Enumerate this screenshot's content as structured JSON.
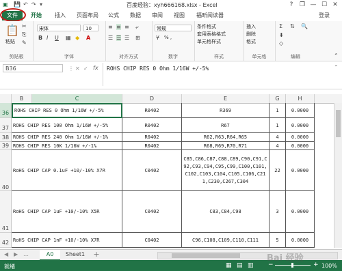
{
  "titlebar": {
    "title": "百度经验：xyh666168.xlsx - Excel",
    "help": "?",
    "restore": "❐",
    "minimize": "—",
    "maximize": "☐",
    "close": "✕"
  },
  "tabs": {
    "file": "文件",
    "items": [
      "开始",
      "插入",
      "页面布局",
      "公式",
      "数据",
      "审阅",
      "视图",
      "福昕阅读器"
    ],
    "login": "登录"
  },
  "ribbon": {
    "paste": "粘贴",
    "clipboard_label": "剪贴板",
    "font_name": "宋体",
    "font_size": "10",
    "font_label": "字体",
    "bold": "B",
    "italic": "I",
    "underline": "U",
    "align_label": "对齐方式",
    "number_format": "常规",
    "number_symbols": "% ,",
    "number_label": "数字",
    "styles": [
      "条件格式",
      "套用表格格式",
      "单元格样式"
    ],
    "styles_label": "样式",
    "cells": [
      "插入",
      "删除",
      "格式"
    ],
    "cells_label": "单元格",
    "edit_label": "编辑"
  },
  "formula_bar": {
    "namebox": "B36",
    "fx": "fx",
    "content": "ROHS CHIP RES 0 Ohm 1/16W +/-5%"
  },
  "columns": [
    "B",
    "C",
    "D",
    "E",
    "F",
    "G",
    "H"
  ],
  "rows": [
    {
      "num": "36",
      "b": "ROHS CHIP RES 0 Ohm 1/16W +/-5%",
      "d": "R0402",
      "e": "R369",
      "g": "1",
      "h": "0.0000"
    },
    {
      "num": "37",
      "b": "ROHS CHIP RES 100 Ohm 1/16W +/-5%",
      "d": "R0402",
      "e": "R67",
      "g": "1",
      "h": "0.0000"
    },
    {
      "num": "38",
      "b": "ROHS CHIP RES 240 Ohm 1/16W +/-1%",
      "d": "R0402",
      "e": "R62,R63,R64,R65",
      "g": "4",
      "h": "0.0000"
    },
    {
      "num": "39",
      "b": "ROHS CHIP RES 10K 1/16W +/-1%",
      "d": "R0402",
      "e": "R68,R69,R70,R71",
      "g": "4",
      "h": "0.0000"
    },
    {
      "num": "40",
      "b": "RoHS CHIP CAP 0.1uF +10/-10% X7R",
      "d": "C0402",
      "e": "C85,C86,C87,C88,C89,C90,C91,C92,C93,C94,C95,C99,C100,C101,C102,C103,C104,C105,C106,C211,C230,C267,C304",
      "g": "22",
      "h": "0.0000"
    },
    {
      "num": "41",
      "b": "RoHS CHIP CAP 1uF +10/-10% X5R",
      "d": "C0402",
      "e": "C83,C84,C98",
      "g": "3",
      "h": "0.0000"
    },
    {
      "num": "42",
      "b": "RoHS CHIP CAP 1nF +10/-10% X7R",
      "d": "C0402",
      "e": "C96,C108,C109,C110,C111",
      "g": "5",
      "h": "0.0000"
    }
  ],
  "sheets": {
    "active": "A0",
    "other": "Sheet1",
    "add": "+"
  },
  "status": {
    "ready": "就绪",
    "zoom": "100%",
    "watermark": "Bai 经验"
  },
  "colors": {
    "accent": "#217346",
    "file_circle": "#c0201a"
  }
}
